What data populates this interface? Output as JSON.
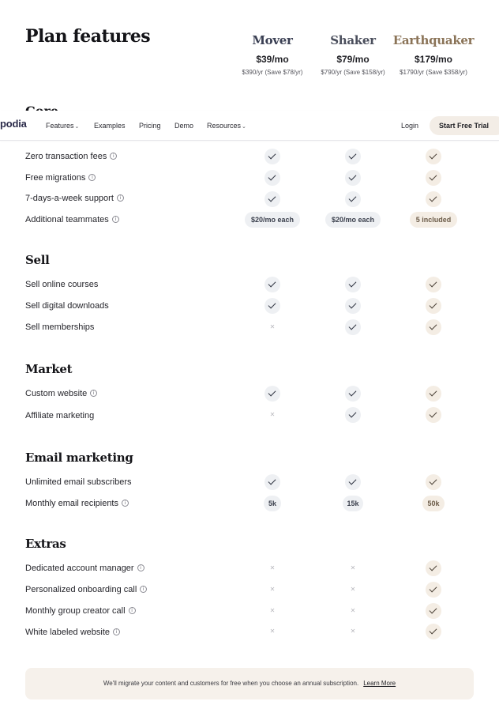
{
  "title": "Plan features",
  "colors": {
    "mover": "#3b4054",
    "shaker": "#4a4e5c",
    "earthquaker": "#8a7357"
  },
  "plans": [
    {
      "name": "Mover",
      "price": "$39/mo",
      "annual": "$390/yr (Save $78/yr)"
    },
    {
      "name": "Shaker",
      "price": "$79/mo",
      "annual": "$790/yr (Save $158/yr)"
    },
    {
      "name": "Earthquaker",
      "price": "$179/mo",
      "annual": "$1790/yr (Save $358/yr)"
    }
  ],
  "peek_section": "Core",
  "nav": {
    "logo": "podia",
    "links": [
      "Features",
      "Examples",
      "Pricing",
      "Demo",
      "Resources"
    ],
    "login": "Login",
    "cta": "Start Free Trial"
  },
  "sections": {
    "core": {
      "rows": [
        {
          "label": "Zero transaction fees",
          "info": true,
          "values": [
            "check",
            "check",
            "check"
          ]
        },
        {
          "label": "Free migrations",
          "info": true,
          "values": [
            "check",
            "check",
            "check"
          ]
        },
        {
          "label": "7-days-a-week support",
          "info": true,
          "values": [
            "check",
            "check",
            "check"
          ]
        },
        {
          "label": "Additional teammates",
          "info": true,
          "values": [
            "$20/mo each",
            "$20/mo each",
            "5 included"
          ]
        }
      ]
    },
    "sell": {
      "title": "Sell",
      "rows": [
        {
          "label": "Sell online courses",
          "info": false,
          "values": [
            "check",
            "check",
            "check"
          ]
        },
        {
          "label": "Sell digital downloads",
          "info": false,
          "values": [
            "check",
            "check",
            "check"
          ]
        },
        {
          "label": "Sell memberships",
          "info": false,
          "values": [
            "cross",
            "check",
            "check"
          ]
        }
      ]
    },
    "market": {
      "title": "Market",
      "rows": [
        {
          "label": "Custom website",
          "info": true,
          "values": [
            "check",
            "check",
            "check"
          ]
        },
        {
          "label": "Affiliate marketing",
          "info": false,
          "values": [
            "cross",
            "check",
            "check"
          ]
        }
      ]
    },
    "email": {
      "title": "Email marketing",
      "rows": [
        {
          "label": "Unlimited email subscribers",
          "info": false,
          "values": [
            "check",
            "check",
            "check"
          ]
        },
        {
          "label": "Monthly email recipients",
          "info": true,
          "values": [
            "5k",
            "15k",
            "50k"
          ]
        }
      ]
    },
    "extras": {
      "title": "Extras",
      "rows": [
        {
          "label": "Dedicated account manager",
          "info": true,
          "values": [
            "cross",
            "cross",
            "check"
          ]
        },
        {
          "label": "Personalized onboarding call",
          "info": true,
          "values": [
            "cross",
            "cross",
            "check"
          ]
        },
        {
          "label": "Monthly group creator call",
          "info": true,
          "values": [
            "cross",
            "cross",
            "check"
          ]
        },
        {
          "label": "White labeled website",
          "info": true,
          "values": [
            "cross",
            "cross",
            "check"
          ]
        }
      ]
    }
  },
  "banner": {
    "text": "We'll migrate your content and customers for free when you choose an annual subscription.",
    "link": "Learn More"
  }
}
